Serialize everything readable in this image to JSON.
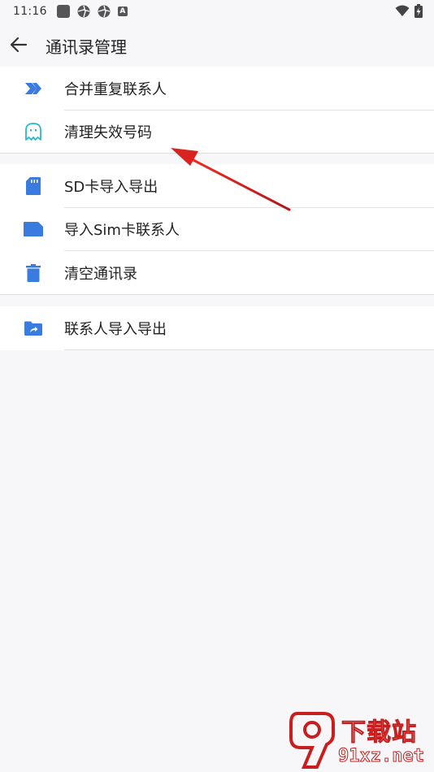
{
  "status_bar": {
    "time": "11:16"
  },
  "app_bar": {
    "title": "通讯录管理"
  },
  "groups": [
    {
      "items": [
        {
          "label": "合并重复联系人",
          "icon": "merge-arrow-icon"
        },
        {
          "label": "清理失效号码",
          "icon": "ghost-icon"
        }
      ]
    },
    {
      "items": [
        {
          "label": "SD卡导入导出",
          "icon": "sd-card-icon"
        },
        {
          "label": "导入Sim卡联系人",
          "icon": "sim-card-icon"
        },
        {
          "label": "清空通讯录",
          "icon": "trash-icon"
        }
      ]
    },
    {
      "items": [
        {
          "label": "联系人导入导出",
          "icon": "folder-share-icon"
        }
      ]
    }
  ],
  "colors": {
    "accent": "#3a7be0",
    "annotation": "#d9231f",
    "watermark": "#c81e1e"
  },
  "watermark": {
    "brand": "下载站",
    "domain": "91xz.net"
  }
}
